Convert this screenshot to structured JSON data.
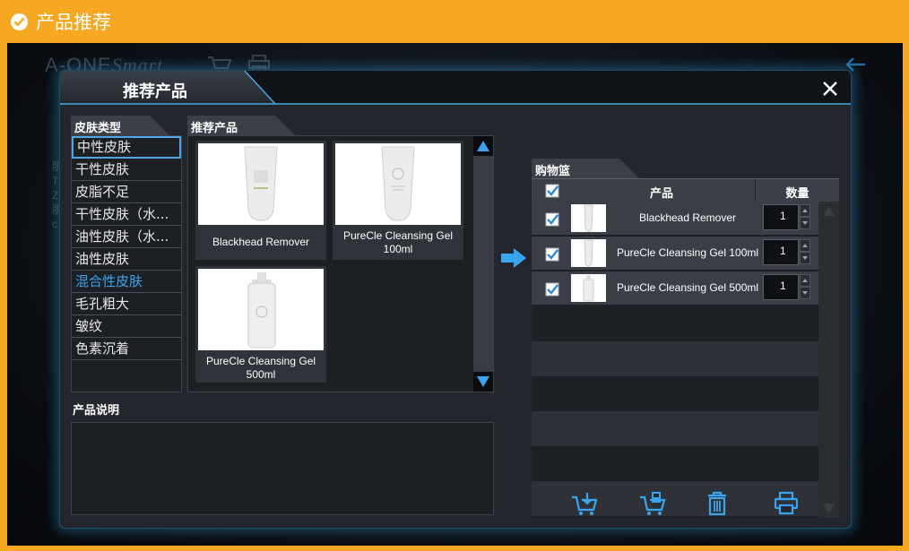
{
  "banner": {
    "title": "产品推荐"
  },
  "background": {
    "logo_text": "A-ONE",
    "logo_script": "Smart",
    "side_text": [
      "肌",
      "T",
      "Z",
      "肌",
      "",
      "c"
    ]
  },
  "dialog": {
    "title": "推荐产品"
  },
  "skin_types": {
    "header": "皮肤类型",
    "items": [
      {
        "label": "中性皮肤",
        "selected": true
      },
      {
        "label": "干性皮肤"
      },
      {
        "label": "皮脂不足"
      },
      {
        "label": "干性皮肤（水..."
      },
      {
        "label": "油性皮肤（水..."
      },
      {
        "label": "油性皮肤"
      },
      {
        "label": "混合性皮肤",
        "active": true
      },
      {
        "label": "毛孔粗大"
      },
      {
        "label": "皱纹"
      },
      {
        "label": "色素沉着"
      }
    ]
  },
  "recommended": {
    "header": "推荐产品",
    "products": [
      {
        "name": "Blackhead Remover"
      },
      {
        "name": "PureCle Cleansing Gel 100ml"
      },
      {
        "name": "PureCle Cleansing Gel 500ml"
      }
    ]
  },
  "cart": {
    "header": "购物篮",
    "col_product": "产品",
    "col_qty": "数量",
    "rows": [
      {
        "name": "Blackhead Remover",
        "qty": "1",
        "checked": true
      },
      {
        "name": "PureCle Cleansing Gel 100ml",
        "qty": "1",
        "checked": true
      },
      {
        "name": "PureCle Cleansing Gel 500ml",
        "qty": "1",
        "checked": true
      }
    ]
  },
  "description": {
    "label": "产品说明"
  },
  "colors": {
    "banner": "#F7A823",
    "accent": "#3aa4f0",
    "glow": "#2e96d2",
    "panel": "#23272d"
  },
  "icons": {
    "banner": "check-circle-icon",
    "close": "close-icon",
    "scroll_up": "triangle-up-icon",
    "scroll_down": "triangle-down-icon",
    "add": "arrow-right-icon",
    "actions": [
      "cart-add-icon",
      "cart-save-icon",
      "trash-icon",
      "printer-icon"
    ]
  }
}
